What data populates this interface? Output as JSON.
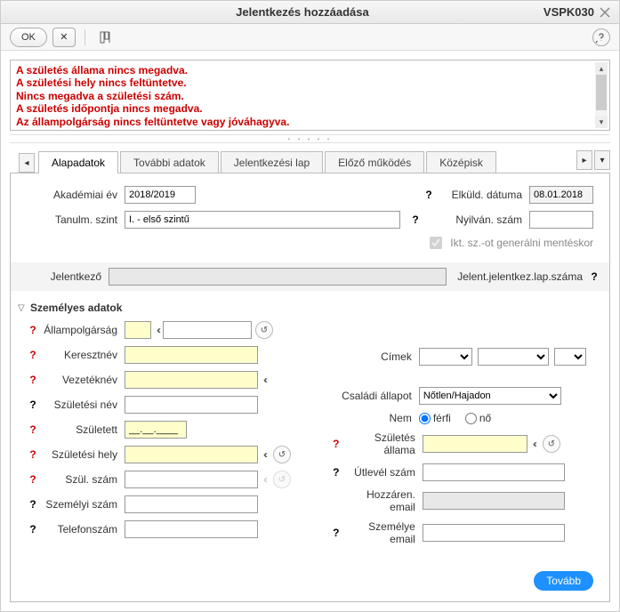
{
  "titlebar": {
    "title": "Jelentkezés hozzáadása",
    "code": "VSPK030"
  },
  "toolbar": {
    "ok": "OK",
    "cancel": "✕",
    "tool": "⎙"
  },
  "errors": [
    "A születés állama nincs megadva.",
    "A születési hely nincs feltüntetve.",
    "Nincs megadva a születési szám.",
    "A születés időpontja nincs megadva.",
    "Az állampolgárság nincs feltüntetve vagy jóváhagyva."
  ],
  "tabs": {
    "t1": "Alapadatok",
    "t2": "További adatok",
    "t3": "Jelentkezési lap",
    "t4": "Előző működés",
    "t5": "Középisk"
  },
  "top": {
    "akad_label": "Akadémiai év",
    "akad_value": "2018/2019",
    "elkuld_label": "Elküld. dátuma",
    "elkuld_value": "08.01.2018",
    "tanulm_label": "Tanulm. szint",
    "tanulm_value": "I. - első szintű",
    "nyilv_label": "Nyilván. szám",
    "nyilv_value": "",
    "ikt_label": "Ikt. sz.-ot generálni mentéskor"
  },
  "jelentkezo": {
    "label": "Jelentkező",
    "value": "",
    "right_label": "Jelent.jelentkez.lap.száma"
  },
  "section": {
    "title": "Személyes adatok"
  },
  "fields": {
    "allamp": "Állampolgárság",
    "kereszt": "Keresztnév",
    "vezetek": "Vezetéknév",
    "szulnev": "Születési név",
    "szuletett": "Született",
    "szuletett_mask": "__.__.____",
    "szulhely": "Születési hely",
    "szulszam": "Szül. szám",
    "szemelyiszam": "Személyi szám",
    "telefon": "Telefonszám",
    "cimek": "Címek",
    "csalad": "Családi állapot",
    "csalad_value": "Nőtlen/Hajadon",
    "nem": "Nem",
    "nem_ferfi": "férfi",
    "nem_no": "nő",
    "szulallam": "Születés állama",
    "utlevel": "Útlevél szám",
    "hozzem": "Hozzáren. email",
    "szemem": "Személye email"
  },
  "footer": {
    "next": "Tovább"
  }
}
